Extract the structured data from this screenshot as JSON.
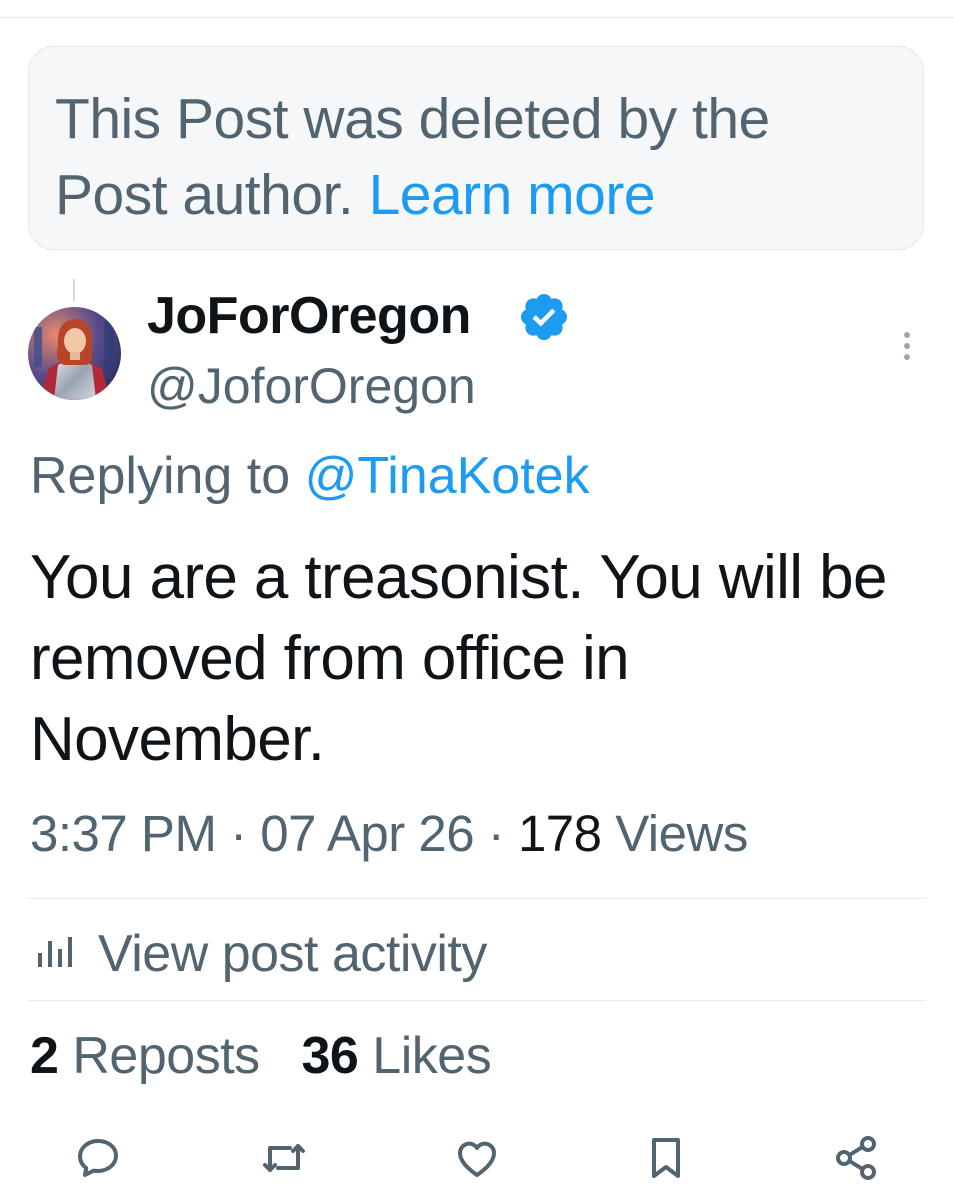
{
  "deleted_notice": {
    "text": "This Post was deleted by the Post author.",
    "link_label": "Learn more"
  },
  "post": {
    "display_name": "JoForOregon",
    "verified": true,
    "handle": "@JoforOregon",
    "replying_prefix": "Replying to",
    "replying_to": "@TinaKotek",
    "text": "You are a treasonist. You will be removed from office in November.",
    "time": "3:37 PM",
    "date": "07 Apr 26",
    "views_count": "178",
    "views_label": "Views",
    "activity_label": "View post activity",
    "reposts_count": "2",
    "reposts_label": "Reposts",
    "likes_count": "36",
    "likes_label": "Likes"
  },
  "icons": {
    "verified": "verified-badge-icon",
    "more": "more-vertical-icon",
    "activity": "bar-chart-icon",
    "reply": "reply-icon",
    "repost": "repost-icon",
    "like": "heart-icon",
    "bookmark": "bookmark-icon",
    "share": "share-icon"
  },
  "colors": {
    "accent": "#1d9bf0",
    "secondary_text": "#536471",
    "primary_text": "#0f1419"
  }
}
